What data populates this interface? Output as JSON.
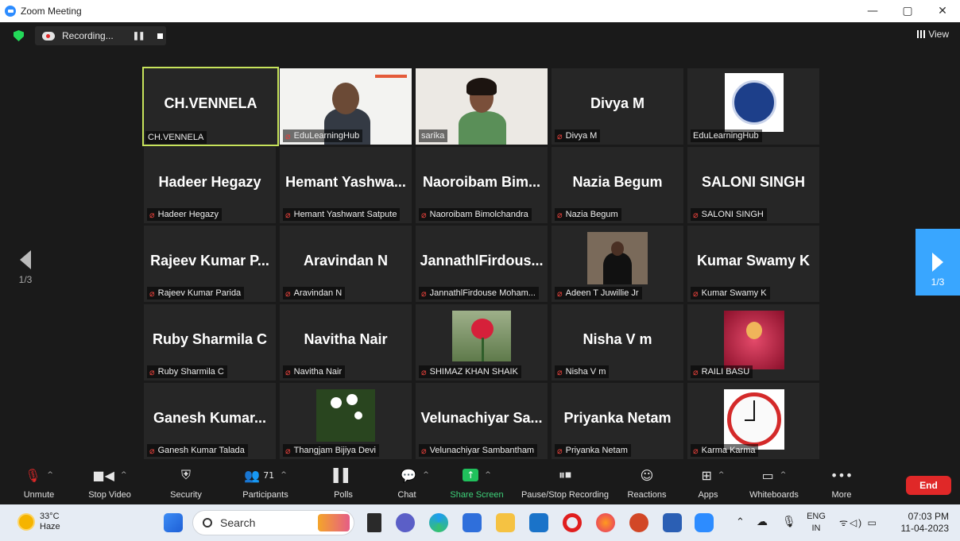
{
  "window": {
    "title": "Zoom Meeting",
    "controls": [
      "—",
      "▢",
      "✕"
    ]
  },
  "topbar": {
    "recording_label": "Recording...",
    "view_label": "View"
  },
  "pagination": {
    "left_label": "1/3",
    "right_label": "1/3"
  },
  "tiles": [
    {
      "big": "CH.VENNELA",
      "label": "CH.VENNELA",
      "muted": false,
      "type": "name",
      "active": true
    },
    {
      "big": "",
      "label": "EduLearningHub",
      "muted": true,
      "type": "video-man"
    },
    {
      "big": "",
      "label": "sarika",
      "muted": false,
      "type": "video-woman"
    },
    {
      "big": "Divya M",
      "label": "Divya M",
      "muted": true,
      "type": "name"
    },
    {
      "big": "",
      "label": "EduLearningHub",
      "muted": false,
      "type": "logo"
    },
    {
      "big": "Hadeer Hegazy",
      "label": "Hadeer Hegazy",
      "muted": true,
      "type": "name"
    },
    {
      "big": "Hemant  Yashwa...",
      "label": "Hemant Yashwant Satpute",
      "muted": true,
      "type": "name"
    },
    {
      "big": "Naoroibam  Bim...",
      "label": "Naoroibam Bimolchandra",
      "muted": true,
      "type": "name"
    },
    {
      "big": "Nazia Begum",
      "label": "Nazia Begum",
      "muted": true,
      "type": "name"
    },
    {
      "big": "SALONI SINGH",
      "label": "SALONI SINGH",
      "muted": true,
      "type": "name"
    },
    {
      "big": "Rajeev  Kumar  P...",
      "label": "Rajeev Kumar Parida",
      "muted": true,
      "type": "name"
    },
    {
      "big": "Aravindan N",
      "label": "Aravindan N",
      "muted": true,
      "type": "name"
    },
    {
      "big": "JannathlFirdous...",
      "label": "JannathlFirdouse Moham...",
      "muted": true,
      "type": "name"
    },
    {
      "big": "",
      "label": "Adeen T Juwillie Jr",
      "muted": true,
      "type": "photo-grad"
    },
    {
      "big": "Kumar Swamy K",
      "label": "Kumar Swamy K",
      "muted": true,
      "type": "name"
    },
    {
      "big": "Ruby Sharmila C",
      "label": "Ruby Sharmila C",
      "muted": true,
      "type": "name"
    },
    {
      "big": "Navitha Nair",
      "label": "Navitha Nair",
      "muted": true,
      "type": "name"
    },
    {
      "big": "",
      "label": "SHIMAZ KHAN SHAIK",
      "muted": true,
      "type": "photo-rose"
    },
    {
      "big": "Nisha V m",
      "label": "Nisha V m",
      "muted": true,
      "type": "name"
    },
    {
      "big": "",
      "label": "RAILI BASU",
      "muted": true,
      "type": "photo-goddess"
    },
    {
      "big": "Ganesh  Kumar...",
      "label": "Ganesh Kumar Talada",
      "muted": true,
      "type": "name"
    },
    {
      "big": "",
      "label": "Thangjam Bijiya Devi",
      "muted": true,
      "type": "photo-flower"
    },
    {
      "big": "Velunachiyar  Sa...",
      "label": "Velunachiyar Sambantham",
      "muted": true,
      "type": "name"
    },
    {
      "big": "Priyanka Netam",
      "label": "Priyanka Netam",
      "muted": true,
      "type": "name"
    },
    {
      "big": "",
      "label": "Karma Karma",
      "muted": true,
      "type": "photo-clock"
    }
  ],
  "toolbar": {
    "unmute": "Unmute",
    "stop_video": "Stop Video",
    "security": "Security",
    "participants": "Participants",
    "participants_count": "71",
    "polls": "Polls",
    "chat": "Chat",
    "share_screen": "Share Screen",
    "pause_stop_recording": "Pause/Stop Recording",
    "reactions": "Reactions",
    "apps": "Apps",
    "whiteboards": "Whiteboards",
    "more": "More",
    "end": "End"
  },
  "taskbar": {
    "temperature": "33°C",
    "weather": "Haze",
    "search": "Search",
    "lang_top": "ENG",
    "lang_bottom": "IN",
    "time": "07:03 PM",
    "date": "11-04-2023"
  },
  "colors": {
    "accent_blue": "#2d8cff",
    "end_red": "#e02828",
    "share_green": "#20c05c",
    "active_border": "#c7e35b"
  }
}
